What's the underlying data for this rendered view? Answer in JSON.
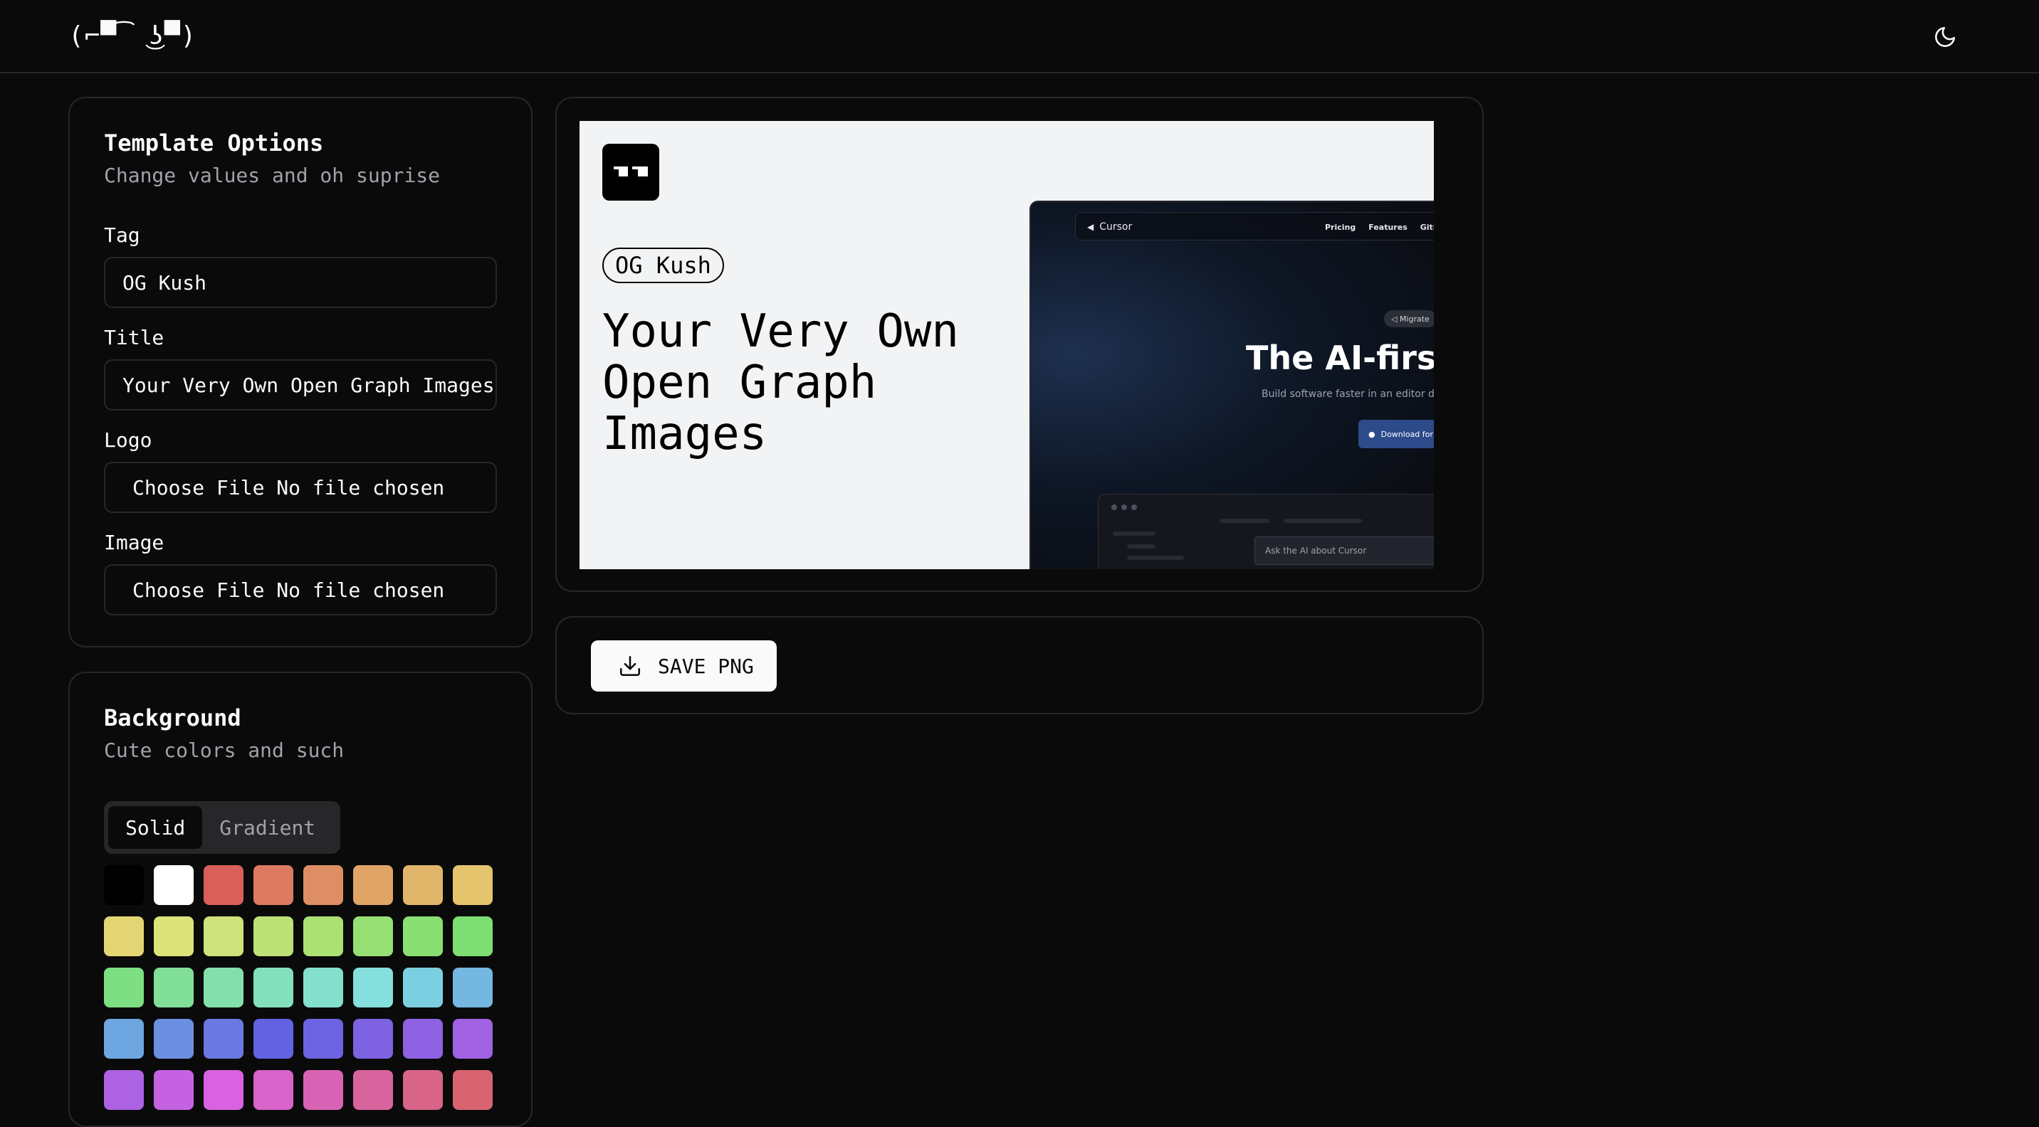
{
  "header": {
    "brand": "(⌐▀͡ ͜ʖ▀)",
    "theme_icon": "moon-icon"
  },
  "template_options": {
    "title": "Template Options",
    "subtitle": "Change values and oh suprise",
    "tag_label": "Tag",
    "tag_value": "OG Kush",
    "title_label": "Title",
    "title_value": "Your Very Own Open Graph Images",
    "logo_label": "Logo",
    "logo_file": "Choose File No file chosen",
    "image_label": "Image",
    "image_file": "Choose File No file chosen"
  },
  "background": {
    "title": "Background",
    "subtitle": "Cute colors and such",
    "tabs": [
      "Solid",
      "Gradient"
    ],
    "active_tab": "Solid",
    "swatches": [
      "#000000",
      "#ffffff",
      "#d9605a",
      "#dd7a62",
      "#de8e64",
      "#e0a466",
      "#e2b66a",
      "#e4c46c",
      "#e4d574",
      "#dde27a",
      "#cde27a",
      "#bde177",
      "#abe073",
      "#98df73",
      "#89df71",
      "#7ddf73",
      "#7ddf82",
      "#82df98",
      "#83dfab",
      "#84dfbd",
      "#84dfcd",
      "#84dfdd",
      "#7ccfe0",
      "#74b8e1",
      "#6ea6e1",
      "#6c8fe2",
      "#6a79e2",
      "#6462e2",
      "#6d63e2",
      "#7d62e2",
      "#8e62e2",
      "#a062e2",
      "#ac62e2",
      "#c462e2",
      "#d862e2",
      "#d863c9",
      "#d863b4",
      "#d8649e",
      "#d86488",
      "#d86472"
    ]
  },
  "preview": {
    "logo_glyph": "▀͡▀",
    "tag": "OG Kush",
    "title": "Your Very Own Open Graph Images",
    "screenshot": {
      "nav_brand": "Cursor",
      "nav_links": [
        "Pricing",
        "Features",
        "GitHub"
      ],
      "badge": "◁ Migrate",
      "headline": "The AI-first",
      "subtext": "Build software faster in an editor de",
      "cta": "Download for",
      "ask_placeholder": "Ask the AI about Cursor"
    }
  },
  "actions": {
    "save_label": "SAVE PNG",
    "save_icon": "download-icon"
  }
}
